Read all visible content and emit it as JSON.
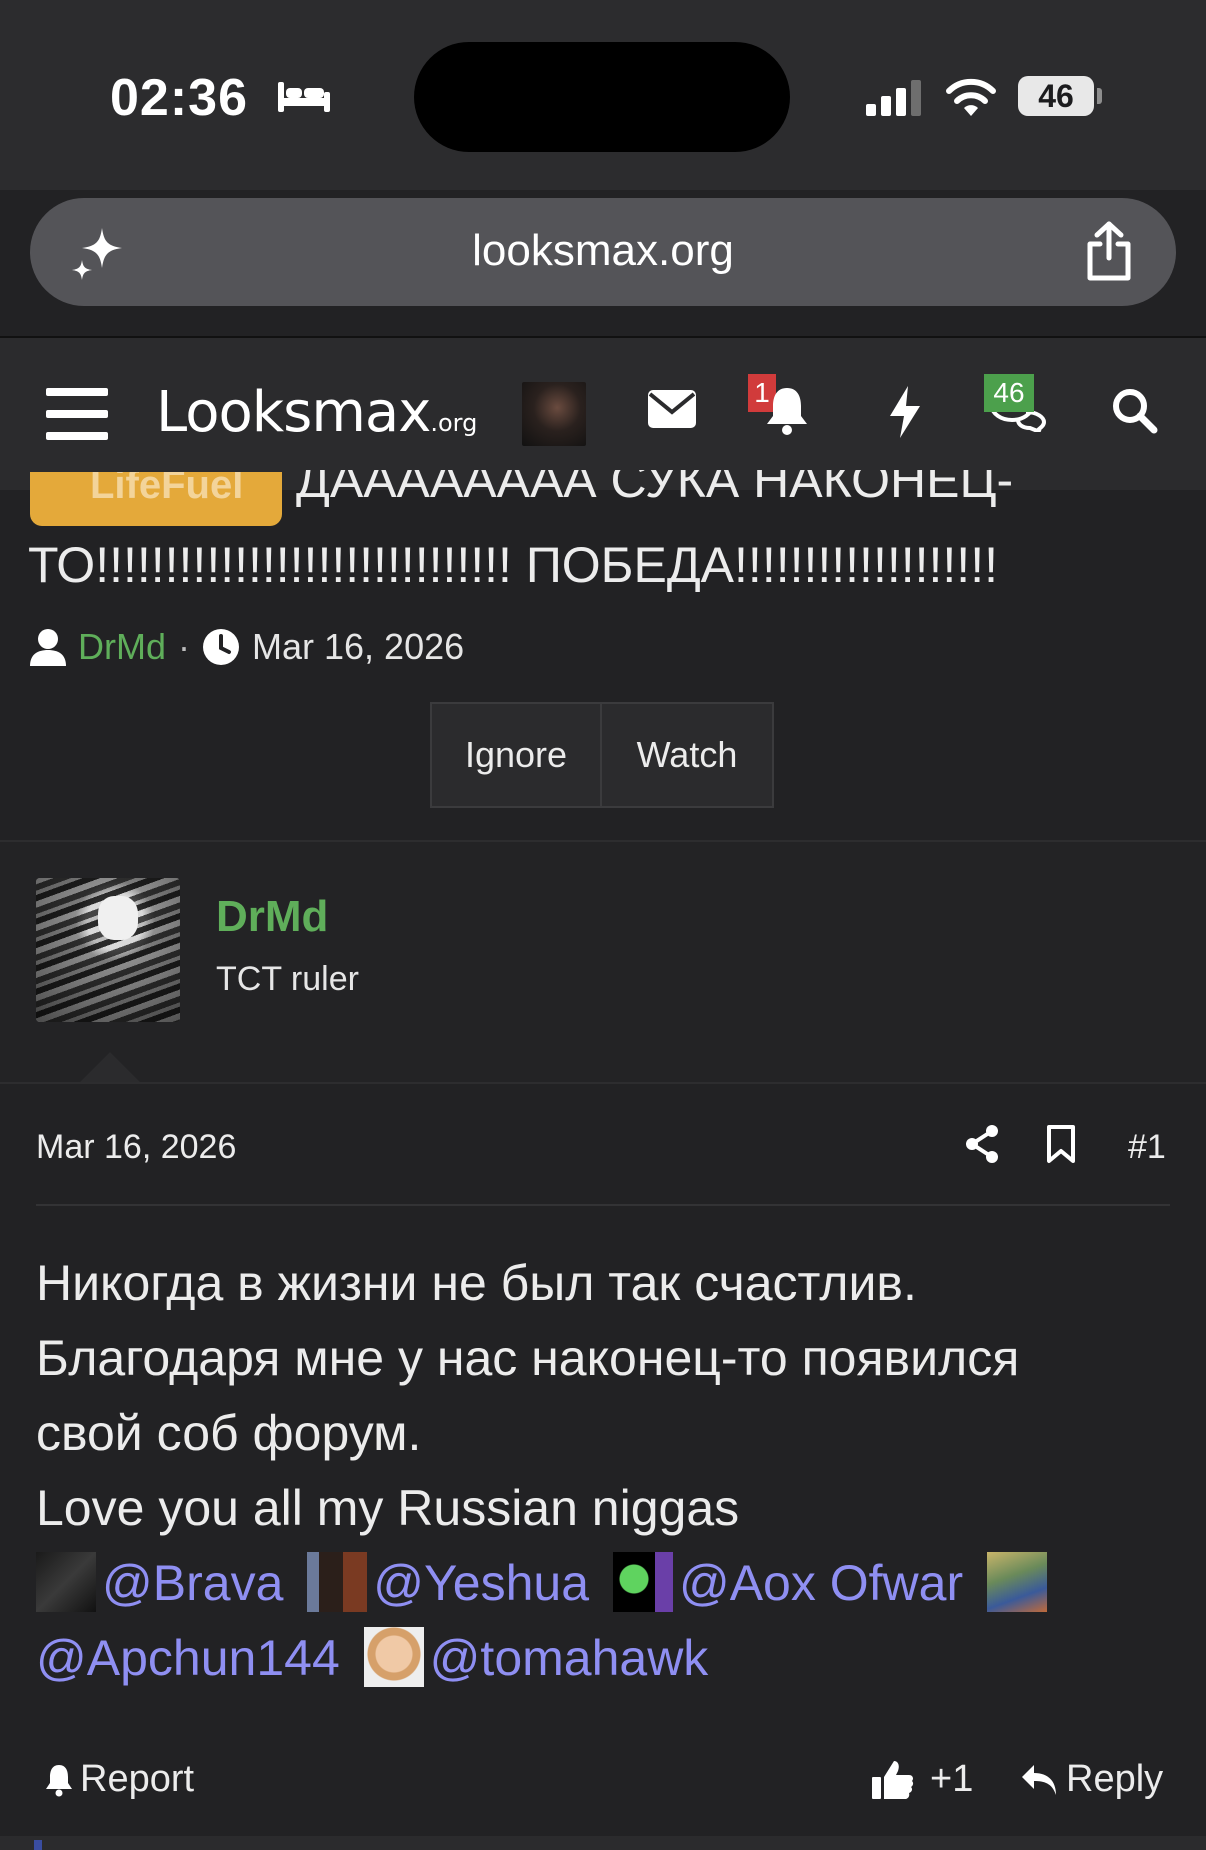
{
  "status_bar": {
    "time": "02:36",
    "battery": "46",
    "icons": [
      "bed-sleep-icon",
      "cellular-signal-icon",
      "wifi-icon",
      "battery-icon"
    ]
  },
  "browser": {
    "url": "looksmax.org",
    "icons": [
      "sparkle-icon",
      "share-icon"
    ]
  },
  "nav": {
    "logo_main": "Looksmax",
    "logo_suffix": ".org",
    "alerts_badge": "1",
    "conversations_badge": "46",
    "icons": [
      "hamburger-menu-icon",
      "user-avatar",
      "mail-icon",
      "bell-icon",
      "bolt-icon",
      "chat-bubbles-icon",
      "search-icon"
    ]
  },
  "thread": {
    "prefix": "LifeFuel",
    "title_line1_partial": "ДАААААААА СУКА НАКОНЕЦ-",
    "title_line2": "ТО!!!!!!!!!!!!!!!!!!!!!!!!!!!!!! ПОБЕДА!!!!!!!!!!!!!!!!!!!",
    "author": "DrMd",
    "separator": "·",
    "date": "Mar 16, 2026",
    "buttons": {
      "ignore": "Ignore",
      "watch": "Watch"
    }
  },
  "post": {
    "username": "DrMd",
    "user_title": "TCT ruler",
    "date": "Mar 16, 2026",
    "number": "#1",
    "body": [
      "Никогда в жизни не был так счастлив.",
      "Благодаря мне у нас наконец-то появился",
      "свой соб форум.",
      "Love you all my Russian niggas"
    ],
    "mentions": [
      "@Brava",
      "@Yeshua",
      "@Aox Ofwar",
      "@Apchun144",
      "@tomahawk"
    ],
    "footer": {
      "report": "Report",
      "likes": "+1",
      "reply": "Reply"
    },
    "colors": {
      "username": "#5fae5a",
      "mention": "#8f8ff2",
      "prefix_bg": "#e4a93a"
    }
  }
}
